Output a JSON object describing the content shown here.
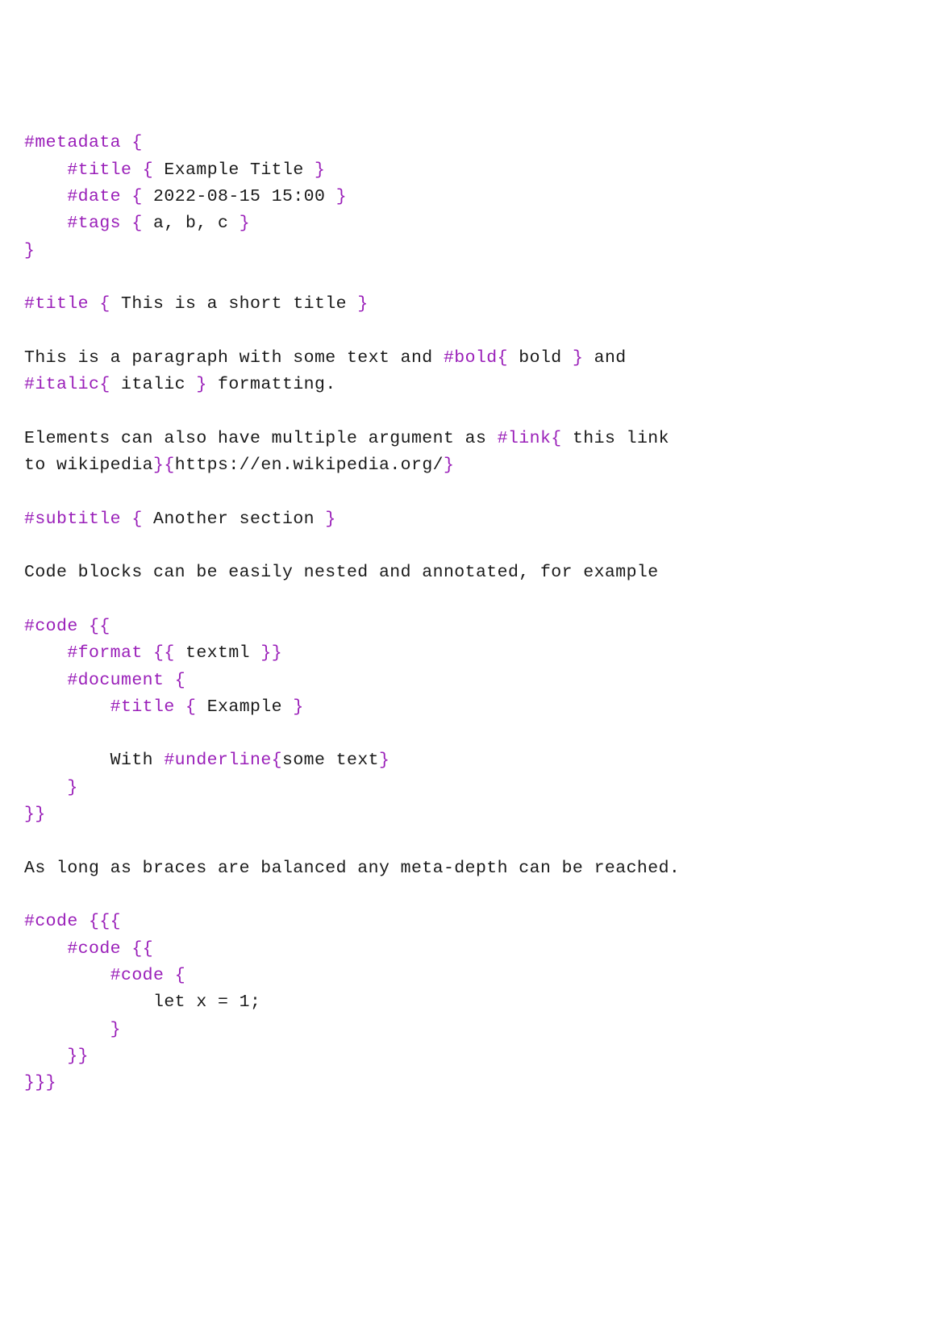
{
  "kw": {
    "metadata": "#metadata",
    "title": "#title",
    "date": "#date",
    "tags": "#tags",
    "bold": "#bold",
    "italic": "#italic",
    "link": "#link",
    "subtitle": "#subtitle",
    "code": "#code",
    "format": "#format",
    "document": "#document",
    "underline": "#underline"
  },
  "br": {
    "o1": "{",
    "c1": "}",
    "o2": "{{",
    "c2": "}}",
    "o3": "{{{",
    "c3": "}}}"
  },
  "txt": {
    "metaTitle": " Example Title ",
    "metaDate": " 2022-08-15 15:00 ",
    "metaTags": " a, b, c ",
    "titleBody": " This is a short title ",
    "para1a": "This is a paragraph with some text and ",
    "boldBody": " bold ",
    "para1b": " and",
    "italicBody": " italic ",
    "para1c": " formatting.",
    "para2a": "Elements can also have multiple argument as ",
    "linkText": " this link",
    "para2b": "to wikipedia",
    "linkHref": "https://en.wikipedia.org/",
    "subtitleBody": " Another section ",
    "para3": "Code blocks can be easily nested and annotated, for example",
    "formatBody": " textml ",
    "docTitleBody": " Example ",
    "docLinePrefix": "With ",
    "underlineBody": "some text",
    "para4": "As long as braces are balanced any meta-depth can be reached.",
    "codeInner": "let x = 1;"
  }
}
